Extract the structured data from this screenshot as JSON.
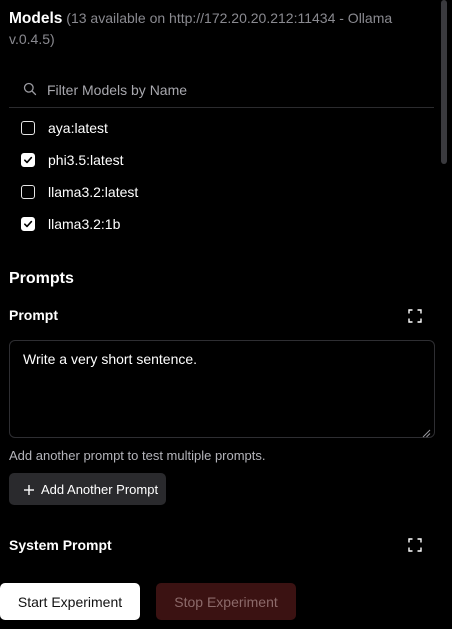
{
  "models": {
    "title": "Models",
    "subtitle": "(13 available on http://172.20.20.212:11434 - Ollama v.0.4.5)",
    "filter_placeholder": "Filter Models by Name",
    "items": [
      {
        "label": "aya:latest",
        "checked": false
      },
      {
        "label": "phi3.5:latest",
        "checked": true
      },
      {
        "label": "llama3.2:latest",
        "checked": false
      },
      {
        "label": "llama3.2:1b",
        "checked": true
      }
    ]
  },
  "prompts": {
    "section_title": "Prompts",
    "prompt_label": "Prompt",
    "prompt_value": "Write a very short sentence.",
    "helper_text": "Add another prompt to test multiple prompts.",
    "add_button_label": "Add Another Prompt",
    "system_prompt_label": "System Prompt"
  },
  "actions": {
    "start_label": "Start Experiment",
    "stop_label": "Stop Experiment"
  },
  "icons": {
    "search": "search-icon",
    "expand": "expand-icon",
    "plus": "plus-icon",
    "check": "check-icon"
  },
  "colors": {
    "background": "#000000",
    "muted_text": "#8a8a90",
    "secondary_button": "#2a2a2d",
    "stop_button": "#3b1212",
    "start_button": "#ffffff"
  }
}
